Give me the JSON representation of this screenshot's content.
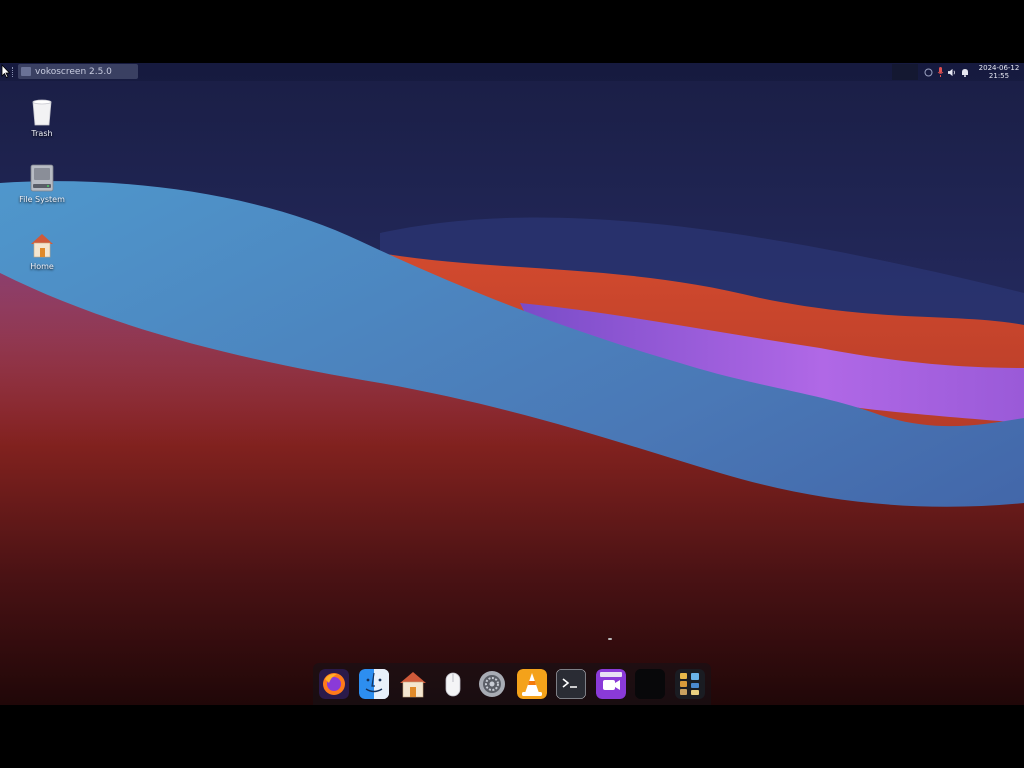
{
  "top_panel": {
    "window_button_label": "vokoscreen 2.5.0",
    "clock_date": "2024-06-12",
    "clock_time": "21:55",
    "tray_icons": [
      "network-icon",
      "microphone-icon",
      "volume-icon",
      "notification-bell-icon"
    ]
  },
  "desktop_icons": [
    {
      "name": "trash",
      "label": "Trash",
      "icon": "trash-icon"
    },
    {
      "name": "file-system",
      "label": "File System",
      "icon": "hard-drive-icon"
    },
    {
      "name": "home",
      "label": "Home",
      "icon": "home-folder-icon"
    }
  ],
  "dock": {
    "items": [
      {
        "name": "firefox",
        "icon": "firefox-icon"
      },
      {
        "name": "finder",
        "icon": "finder-icon"
      },
      {
        "name": "home-folder",
        "icon": "home-icon"
      },
      {
        "name": "mouse-settings",
        "icon": "mouse-icon"
      },
      {
        "name": "system-settings",
        "icon": "settings-gear-icon"
      },
      {
        "name": "vlc",
        "icon": "vlc-cone-icon"
      },
      {
        "name": "terminal",
        "icon": "terminal-icon"
      },
      {
        "name": "vokoscreen",
        "icon": "screen-recorder-icon"
      },
      {
        "name": "blank-app",
        "icon": "black-window-icon"
      },
      {
        "name": "app-launcher",
        "icon": "app-grid-icon"
      }
    ],
    "running_indicator_app": "vokoscreen"
  },
  "colors": {
    "sky_top": "#1c2147",
    "wave_red": "#c8442e",
    "wave_purple": "#a05ae0",
    "wave_blue": "#4a8ec4",
    "foreground_dark_red": "#3a0f12"
  }
}
